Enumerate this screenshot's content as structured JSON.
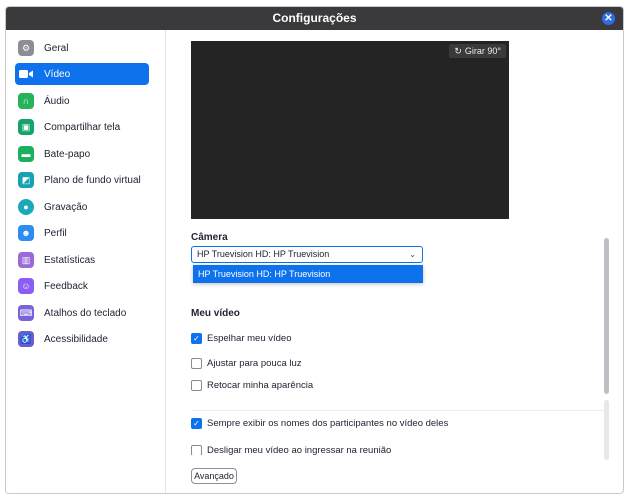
{
  "window": {
    "title": "Configurações"
  },
  "sidebar": {
    "items": [
      {
        "label": "Geral",
        "icon": "gear-icon",
        "color": "#8d8d95"
      },
      {
        "label": "Vídeo",
        "icon": "video-camera-icon",
        "color": "#0e72ed",
        "active": true
      },
      {
        "label": "Áudio",
        "icon": "headphones-icon",
        "color": "#27b35c"
      },
      {
        "label": "Compartilhar tela",
        "icon": "share-screen-icon",
        "color": "#16a36a"
      },
      {
        "label": "Bate-papo",
        "icon": "chat-icon",
        "color": "#1bb061"
      },
      {
        "label": "Plano de fundo virtual",
        "icon": "virtual-background-icon",
        "color": "#17a2b3"
      },
      {
        "label": "Gravação",
        "icon": "recording-icon",
        "color": "#19a9b8"
      },
      {
        "label": "Perfil",
        "icon": "profile-icon",
        "color": "#2d8cf0"
      },
      {
        "label": "Estatísticas",
        "icon": "statistics-icon",
        "color": "#9a6ad8"
      },
      {
        "label": "Feedback",
        "icon": "feedback-icon",
        "color": "#8b5cf6"
      },
      {
        "label": "Atalhos do teclado",
        "icon": "keyboard-icon",
        "color": "#7a63d8"
      },
      {
        "label": "Acessibilidade",
        "icon": "accessibility-icon",
        "color": "#6d5bd0"
      }
    ]
  },
  "video": {
    "rotate_label": "Girar 90°",
    "camera_heading": "Câmera",
    "camera_selected": "HP Truevision HD: HP Truevision",
    "camera_option": "HP Truevision HD: HP Truevision",
    "my_video_heading": "Meu vídeo",
    "options": [
      {
        "label": "Espelhar meu vídeo",
        "checked": true
      },
      {
        "label": "Ajustar para pouca luz",
        "checked": false
      },
      {
        "label": "Retocar minha aparência",
        "checked": false
      },
      {
        "label": "Sempre exibir os nomes dos participantes no vídeo deles",
        "checked": true
      },
      {
        "label": "Desligar meu vídeo ao ingressar na reunião",
        "checked": false
      }
    ],
    "advanced_label": "Avançado"
  }
}
